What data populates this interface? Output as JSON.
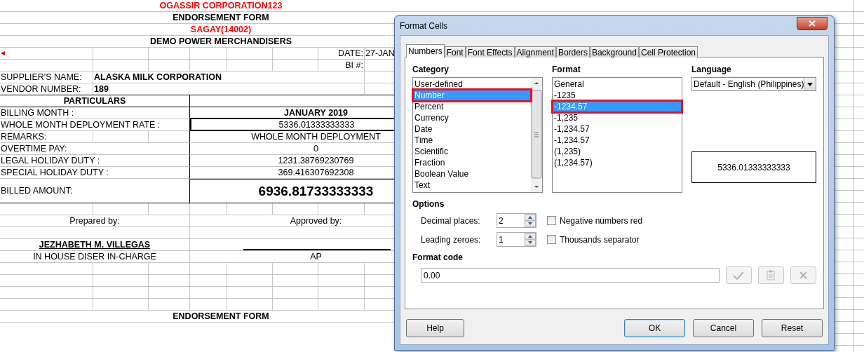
{
  "sheet": {
    "company": "OGASSIR CORPORATION123",
    "form_title": "ENDORSEMENT FORM",
    "branch": "SAGAY(14002)",
    "agency": "DEMO POWER MERCHANDISERS",
    "date_label": "DATE:",
    "date_value": "27-JAN",
    "bi_label": "BI #:",
    "supplier_label": "SUPPLIER'S NAME:",
    "supplier_name": "ALASKA MILK CORPORATION",
    "vendor_label": "VENDOR NUMBER:",
    "vendor_number": "189",
    "particulars_header": "PARTICULARS",
    "particulars": [
      {
        "kind": "bold",
        "label": "BILLING MONTH :",
        "value": "JANUARY 2019"
      },
      {
        "kind": "boxed",
        "label": "WHOLE MONTH DEPLOYMENT RATE :",
        "value": "5336.01333333333"
      },
      {
        "kind": "split",
        "label": "REMARKS:",
        "value": "WHOLE MONTH DEPLOYMENT"
      },
      {
        "kind": "plain",
        "label": "OVERTIME PAY:",
        "value": "0"
      },
      {
        "kind": "plain",
        "label": "LEGAL HOLIDAY DUTY :",
        "value": "1231.38769230769"
      },
      {
        "kind": "plain",
        "label": "SPECIAL HOLIDAY DUTY :",
        "value": "369.416307692308"
      },
      {
        "kind": "total",
        "label": "BILLED AMOUNT:",
        "value": "6936.81733333333"
      }
    ],
    "prepared_label": "Prepared by:",
    "approved_label": "Approved by:",
    "preparer_name": "JEZHABETH M. VILLEGAS",
    "preparer_role": "IN HOUSE DISER IN-CHARGE",
    "approver_role": "AP",
    "footer_title": "ENDORSEMENT FORM"
  },
  "dialog": {
    "title": "Format Cells",
    "tabs": [
      {
        "label": "Numbers",
        "selected": true
      },
      {
        "label": "Font",
        "selected": false
      },
      {
        "label": "Font Effects",
        "selected": false
      },
      {
        "label": "Alignment",
        "selected": false
      },
      {
        "label": "Borders",
        "selected": false
      },
      {
        "label": "Background",
        "selected": false
      },
      {
        "label": "Cell Protection",
        "selected": false
      }
    ],
    "category": {
      "label": "Category",
      "items": [
        {
          "label": "User-defined",
          "selected": false,
          "highlighted": false
        },
        {
          "label": "Number",
          "selected": true,
          "highlighted": true
        },
        {
          "label": "Percent",
          "selected": false,
          "highlighted": false
        },
        {
          "label": "Currency",
          "selected": false,
          "highlighted": false
        },
        {
          "label": "Date",
          "selected": false,
          "highlighted": false
        },
        {
          "label": "Time",
          "selected": false,
          "highlighted": false
        },
        {
          "label": "Scientific",
          "selected": false,
          "highlighted": false
        },
        {
          "label": "Fraction",
          "selected": false,
          "highlighted": false
        },
        {
          "label": "Boolean Value",
          "selected": false,
          "highlighted": false
        },
        {
          "label": "Text",
          "selected": false,
          "highlighted": false
        }
      ]
    },
    "format": {
      "label": "Format",
      "items": [
        {
          "label": "General",
          "selected": false,
          "highlighted": false
        },
        {
          "label": "-1235",
          "selected": false,
          "highlighted": false
        },
        {
          "label": "-1234.57",
          "selected": true,
          "highlighted": true
        },
        {
          "label": "-1,235",
          "selected": false,
          "highlighted": false
        },
        {
          "label": "-1,234.57",
          "selected": false,
          "highlighted": false
        },
        {
          "label": "-1,234.57",
          "selected": false,
          "highlighted": false
        },
        {
          "label": "(1,235)",
          "selected": false,
          "highlighted": false
        },
        {
          "label": "(1,234.57)",
          "selected": false,
          "highlighted": false
        }
      ]
    },
    "language": {
      "label": "Language",
      "value": "Default - English (Philippines)"
    },
    "preview": "5336.01333333333",
    "options": {
      "label": "Options",
      "decimal_label": "Decimal places:",
      "decimal_value": "2",
      "zeroes_label": "Leading zeroes:",
      "zeroes_value": "1",
      "checkboxes": [
        {
          "label": "Negative numbers red",
          "checked": false
        },
        {
          "label": "Thousands separator",
          "checked": false
        }
      ]
    },
    "format_code": {
      "label": "Format code",
      "value": "0.00",
      "actions_disabled": true
    },
    "buttons": [
      {
        "label": "Help",
        "kind": "help",
        "default": false
      },
      {
        "label": "OK",
        "kind": "action",
        "default": true
      },
      {
        "label": "Cancel",
        "kind": "action",
        "default": false
      },
      {
        "label": "Reset",
        "kind": "action",
        "default": false
      }
    ]
  }
}
